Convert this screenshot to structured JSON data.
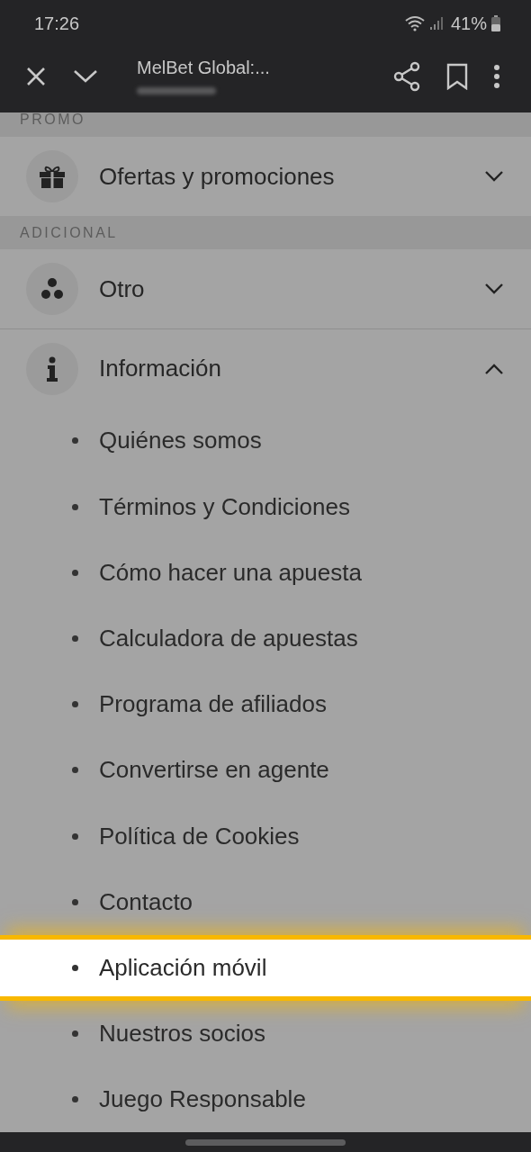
{
  "status_bar": {
    "time": "17:26",
    "battery": "41%"
  },
  "toolbar": {
    "title": "MelBet Global:..."
  },
  "sections": [
    {
      "header": "PROMO",
      "items": [
        {
          "label": "Ofertas y promociones",
          "kind": "gift",
          "expanded": false
        }
      ]
    },
    {
      "header": "ADICIONAL",
      "items": [
        {
          "label": "Otro",
          "kind": "dots",
          "expanded": false
        },
        {
          "label": "Información",
          "kind": "info",
          "expanded": true,
          "children": [
            {
              "label": "Quiénes somos",
              "selected": false
            },
            {
              "label": "Términos y Condiciones",
              "selected": false
            },
            {
              "label": "Cómo hacer una apuesta",
              "selected": false
            },
            {
              "label": "Calculadora de apuestas",
              "selected": false
            },
            {
              "label": "Programa de afiliados",
              "selected": false
            },
            {
              "label": "Convertirse en agente",
              "selected": false
            },
            {
              "label": "Política de Cookies",
              "selected": false
            },
            {
              "label": "Contacto",
              "selected": false
            },
            {
              "label": "Aplicación móvil",
              "selected": true
            },
            {
              "label": "Nuestros socios",
              "selected": false
            },
            {
              "label": "Juego Responsable",
              "selected": false
            }
          ]
        }
      ]
    }
  ]
}
